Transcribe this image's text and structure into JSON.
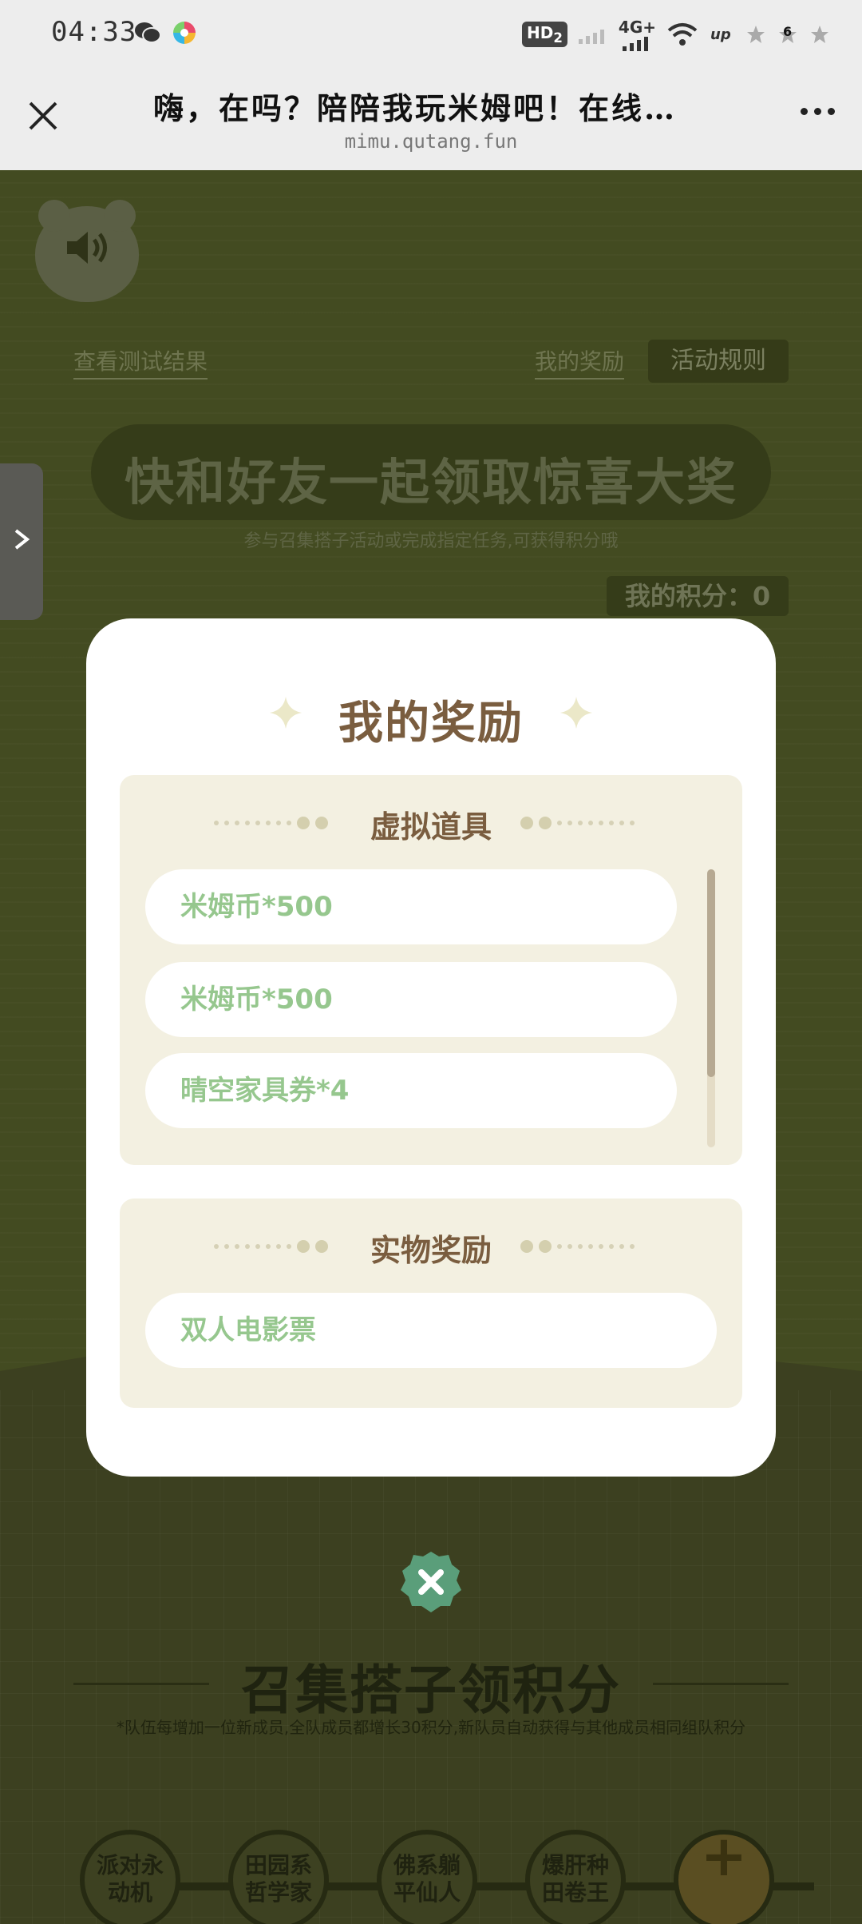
{
  "status_bar": {
    "time": "04:33",
    "hd_label": "HD",
    "hd_sub": "2",
    "network": "4G+",
    "battery_level": "6"
  },
  "browser": {
    "title": "嗨，在吗？陪陪我玩米姆吧！在线…",
    "domain": "mimu.qutang.fun"
  },
  "page": {
    "link_test_result": "查看测试结果",
    "link_my_rewards": "我的奖励",
    "button_rules": "活动规则",
    "banner_title": "快和好友一起领取惊喜大奖",
    "banner_subtitle": "参与召集搭子活动或完成指定任务,可获得积分哦",
    "my_points": "我的积分：0",
    "section_title": "召集搭子领积分",
    "section_note": "*队伍每增加一位新成员,全队成员都增长30积分,新队员自动获得与其他成员相同组队积分",
    "personas": [
      {
        "line1": "派对永",
        "line2": "动机"
      },
      {
        "line1": "田园系",
        "line2": "哲学家"
      },
      {
        "line1": "佛系躺",
        "line2": "平仙人"
      },
      {
        "line1": "爆肝种",
        "line2": "田卷王"
      }
    ],
    "add_member": "+"
  },
  "modal": {
    "title": "我的奖励",
    "virtual_section": {
      "label": "虚拟道具",
      "items": [
        "米姆币*500",
        "米姆币*500",
        "晴空家具券*4"
      ]
    },
    "physical_section": {
      "label": "实物奖励",
      "items": [
        "双人电影票"
      ]
    }
  },
  "colors": {
    "accent_brown": "#7a5d3f",
    "reward_green": "#96c78e",
    "panel_bg": "#f3f0e1",
    "close_green": "#5a9e7a"
  }
}
